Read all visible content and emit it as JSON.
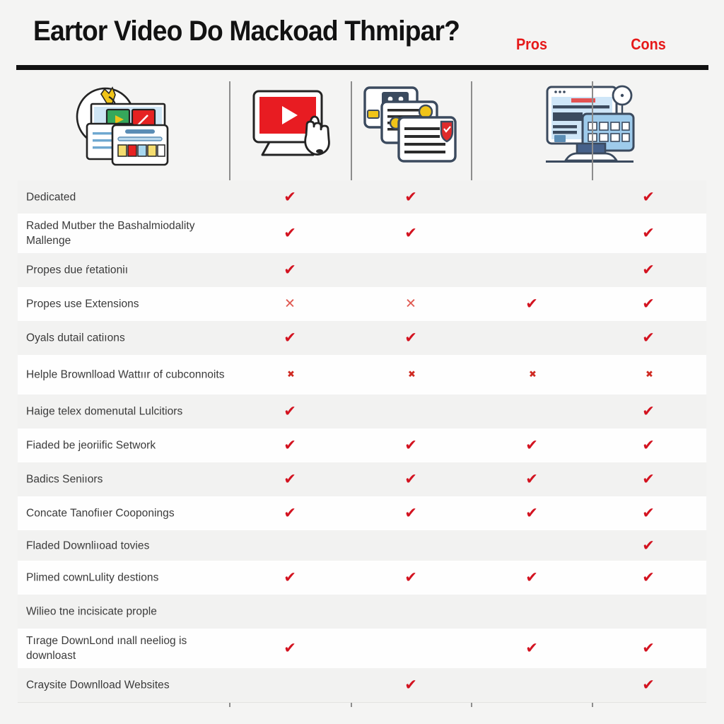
{
  "header": {
    "title": "Eartor Video Do Mackoad Thmipar?",
    "pros_label": "Pros",
    "cons_label": "Cons",
    "rule_color": "#111111",
    "accent_color": "#e61919"
  },
  "columns": [
    {
      "key": "col1",
      "icon": "browser-windows-media-illustration"
    },
    {
      "key": "col2",
      "icon": "monitor-play-button-hand-cursor-illustration"
    },
    {
      "key": "col3",
      "icon": "stacked-cards-shield-lock-illustration"
    },
    {
      "key": "col4",
      "icon": "desktop-monitor-browser-grid-illustration"
    }
  ],
  "marks": {
    "check_symbol": "✔",
    "cross_symbol": "✕",
    "smudge_symbol": "✖",
    "check_color": "#d31320",
    "cross_color": "#e05a52"
  },
  "rows": [
    {
      "label": "Dedicated",
      "cells": [
        "check",
        "check",
        "",
        "check"
      ]
    },
    {
      "label": "Raded Mutber the Bashalmiodality Mallenge",
      "cells": [
        "check",
        "check",
        "",
        "check"
      ]
    },
    {
      "label": "Propes due ŕetationiı",
      "cells": [
        "check",
        "",
        "",
        "check"
      ]
    },
    {
      "label": "Propes use Extensions",
      "cells": [
        "cross",
        "cross",
        "check",
        "check"
      ]
    },
    {
      "label": "Oyals dutail catiıons",
      "cells": [
        "check",
        "check",
        "",
        "check"
      ]
    },
    {
      "label": "Helple Brownlload Wattıır of cubconnoits",
      "cells": [
        "smudge",
        "smudge",
        "smudge",
        "smudge"
      ]
    },
    {
      "label": "Haige telex domenutal Lulcitiors",
      "cells": [
        "check",
        "",
        "",
        "check"
      ]
    },
    {
      "label": "Fiaded be jeoriific Setwork",
      "cells": [
        "check",
        "check",
        "check",
        "check"
      ]
    },
    {
      "label": "Badics Seniıors",
      "cells": [
        "check",
        "check",
        "check",
        "check"
      ]
    },
    {
      "label": "Concate Tanofiıer Cooponings",
      "cells": [
        "check",
        "check",
        "check",
        "check"
      ]
    },
    {
      "label": "Fladed Downliıoad tovies",
      "cells": [
        "",
        "",
        "",
        "check"
      ]
    },
    {
      "label": "Plimed cownLulity destions",
      "cells": [
        "check",
        "check",
        "check",
        "check"
      ]
    },
    {
      "label": "Wilieo tne incisicate prople",
      "cells": [
        "",
        "",
        "",
        ""
      ]
    },
    {
      "label": "Tırage DownLond ınall neeliog is downloast",
      "cells": [
        "check",
        "",
        "check",
        "check"
      ]
    },
    {
      "label": "Craysite Downlload Websites",
      "cells": [
        "",
        "check",
        "",
        "check"
      ]
    }
  ]
}
